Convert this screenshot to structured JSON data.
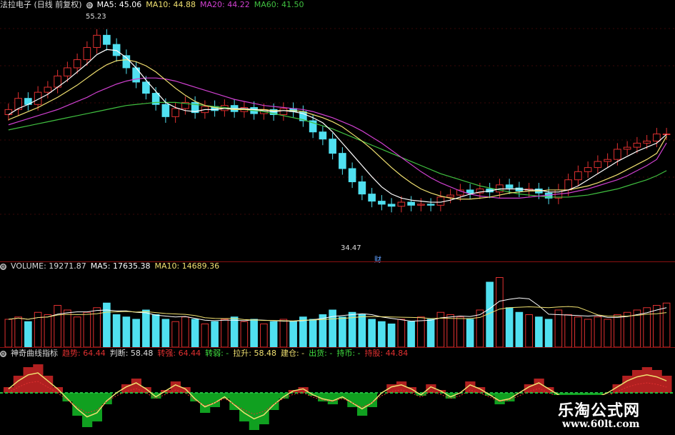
{
  "price_header": {
    "title": "法拉电子 (日线 前复权)",
    "ma5": "MA5: 45.06",
    "ma10": "MA10: 44.88",
    "ma20": "MA20: 44.22",
    "ma60": "MA60: 41.50"
  },
  "price_annotations": {
    "high": "55.23",
    "low": "34.47",
    "marker": "财"
  },
  "volume_header": {
    "volume": "VOLUME: 19271.87",
    "ma5": "MA5: 17635.38",
    "ma10": "MA10: 14689.36"
  },
  "indicator_header": {
    "name": "神奇曲线指标",
    "trend": "趋势: 64.44",
    "judge": "判断: 58.48",
    "turn_strong": "转强: 64.44",
    "turn_weak": "转弱: -",
    "pull_up": "拉升: 58.48",
    "build": "建仓: -",
    "ship": "出货: -",
    "hold": "持币: -",
    "hold_stock": "持股: 44.84"
  },
  "watermark": {
    "title": "乐淘公式网",
    "url": "www.60lt.com"
  },
  "colors": {
    "up": "#e03030",
    "down": "#50e0f0",
    "ma5": "#ffffff",
    "ma10": "#f0e070",
    "ma20": "#d040d0",
    "ma60": "#40c040",
    "axis_red": "#8a1010"
  },
  "chart_data": [
    {
      "type": "candlestick",
      "title": "法拉电子 (日线 前复权)",
      "x_count": 68,
      "ylim": [
        33,
        57
      ],
      "close": [
        47.5,
        48.6,
        48.0,
        49.2,
        49.7,
        50.8,
        51.6,
        52.4,
        53.6,
        54.8,
        53.9,
        52.8,
        51.6,
        50.2,
        49.1,
        48.0,
        46.8,
        47.6,
        48.2,
        47.2,
        47.8,
        47.4,
        47.9,
        47.3,
        47.7,
        47.1,
        47.5,
        47.0,
        47.6,
        47.3,
        46.4,
        45.3,
        44.6,
        43.2,
        41.7,
        40.4,
        39.2,
        38.5,
        38.2,
        38.0,
        38.4,
        38.1,
        38.2,
        38.1,
        38.9,
        39.1,
        39.6,
        39.3,
        39.7,
        39.4,
        40.1,
        39.8,
        39.5,
        39.7,
        39.3,
        38.8,
        39.6,
        40.6,
        41.4,
        41.8,
        42.4,
        42.6,
        43.6,
        43.8,
        44.2,
        44.4,
        45.1,
        45.1
      ],
      "ma5": [
        47.0,
        47.6,
        48.0,
        48.5,
        49.0,
        49.7,
        50.4,
        51.2,
        52.0,
        52.9,
        53.4,
        53.3,
        52.6,
        51.6,
        50.4,
        49.3,
        48.2,
        47.7,
        47.4,
        47.3,
        47.5,
        47.5,
        47.6,
        47.6,
        47.6,
        47.5,
        47.4,
        47.3,
        47.4,
        47.3,
        47.1,
        46.7,
        46.2,
        45.3,
        44.2,
        43.1,
        42.0,
        40.9,
        39.9,
        39.2,
        38.8,
        38.6,
        38.5,
        38.4,
        38.4,
        38.6,
        38.9,
        39.2,
        39.4,
        39.5,
        39.7,
        39.7,
        39.7,
        39.6,
        39.6,
        39.4,
        39.4,
        39.6,
        40.0,
        40.6,
        41.2,
        41.8,
        42.4,
        42.9,
        43.4,
        43.8,
        44.2,
        45.06
      ],
      "ma10": [
        46.5,
        46.9,
        47.3,
        47.7,
        48.2,
        48.7,
        49.3,
        49.9,
        50.6,
        51.3,
        51.9,
        52.3,
        52.4,
        52.2,
        51.8,
        51.2,
        50.4,
        49.6,
        48.9,
        48.3,
        47.9,
        47.7,
        47.6,
        47.5,
        47.5,
        47.5,
        47.5,
        47.4,
        47.4,
        47.4,
        47.3,
        47.0,
        46.7,
        46.3,
        45.8,
        45.1,
        44.4,
        43.6,
        42.7,
        41.8,
        41.0,
        40.3,
        39.7,
        39.3,
        39.0,
        38.8,
        38.7,
        38.7,
        38.8,
        38.9,
        39.1,
        39.3,
        39.4,
        39.5,
        39.5,
        39.6,
        39.6,
        39.6,
        39.8,
        40.0,
        40.3,
        40.7,
        41.1,
        41.6,
        42.1,
        42.6,
        43.2,
        44.88
      ],
      "ma20": [
        46.0,
        46.3,
        46.6,
        46.9,
        47.2,
        47.5,
        47.9,
        48.3,
        48.7,
        49.2,
        49.6,
        50.0,
        50.3,
        50.5,
        50.6,
        50.6,
        50.5,
        50.3,
        50.0,
        49.7,
        49.4,
        49.1,
        48.8,
        48.5,
        48.3,
        48.1,
        47.9,
        47.8,
        47.7,
        47.6,
        47.5,
        47.3,
        47.0,
        46.7,
        46.3,
        45.9,
        45.4,
        44.8,
        44.2,
        43.5,
        42.8,
        42.1,
        41.4,
        40.8,
        40.3,
        39.9,
        39.5,
        39.2,
        39.0,
        38.9,
        38.8,
        38.8,
        38.8,
        38.9,
        39.0,
        39.1,
        39.2,
        39.3,
        39.5,
        39.7,
        40.0,
        40.3,
        40.6,
        41.0,
        41.5,
        42.0,
        42.6,
        44.22
      ],
      "ma60": [
        45.5,
        45.7,
        45.9,
        46.1,
        46.3,
        46.5,
        46.7,
        46.9,
        47.1,
        47.3,
        47.5,
        47.7,
        47.9,
        48.0,
        48.1,
        48.2,
        48.2,
        48.2,
        48.1,
        48.0,
        47.9,
        47.8,
        47.7,
        47.6,
        47.5,
        47.4,
        47.3,
        47.1,
        46.9,
        46.7,
        46.5,
        46.2,
        45.9,
        45.6,
        45.2,
        44.8,
        44.4,
        44.0,
        43.6,
        43.2,
        42.8,
        42.4,
        42.0,
        41.6,
        41.2,
        40.9,
        40.6,
        40.3,
        40.0,
        39.8,
        39.6,
        39.4,
        39.2,
        39.1,
        39.0,
        38.9,
        38.9,
        38.9,
        39.0,
        39.1,
        39.3,
        39.5,
        39.7,
        40.0,
        40.3,
        40.6,
        41.0,
        41.5
      ]
    },
    {
      "type": "bar",
      "title": "VOLUME",
      "values": [
        12,
        13,
        11,
        15,
        14,
        18,
        16,
        13,
        15,
        17,
        19,
        14,
        13,
        12,
        16,
        14,
        12,
        11,
        13,
        12,
        10,
        11,
        12,
        13,
        11,
        12,
        10,
        11,
        12,
        11,
        13,
        12,
        14,
        16,
        13,
        15,
        14,
        12,
        11,
        10,
        12,
        11,
        13,
        12,
        15,
        14,
        13,
        12,
        16,
        28,
        30,
        17,
        15,
        14,
        13,
        12,
        16,
        14,
        13,
        12,
        13,
        12,
        14,
        15,
        16,
        17,
        18,
        19
      ],
      "ylim": [
        0,
        32
      ]
    },
    {
      "type": "area",
      "title": "神奇曲线指标",
      "values": [
        2,
        6,
        9,
        10,
        6,
        2,
        -3,
        -8,
        -12,
        -10,
        -4,
        0,
        3,
        5,
        2,
        -2,
        1,
        4,
        2,
        -3,
        -7,
        -5,
        -2,
        -6,
        -10,
        -13,
        -11,
        -6,
        -2,
        1,
        2,
        -1,
        -3,
        -4,
        -2,
        -5,
        -8,
        -5,
        0,
        3,
        4,
        2,
        -1,
        3,
        1,
        -2,
        0,
        4,
        2,
        -1,
        -4,
        -3,
        0,
        3,
        5,
        2,
        -1,
        -4,
        -6,
        -5,
        -2,
        0,
        3,
        6,
        8,
        9,
        8,
        6
      ],
      "ylim": [
        -14,
        11
      ]
    }
  ]
}
